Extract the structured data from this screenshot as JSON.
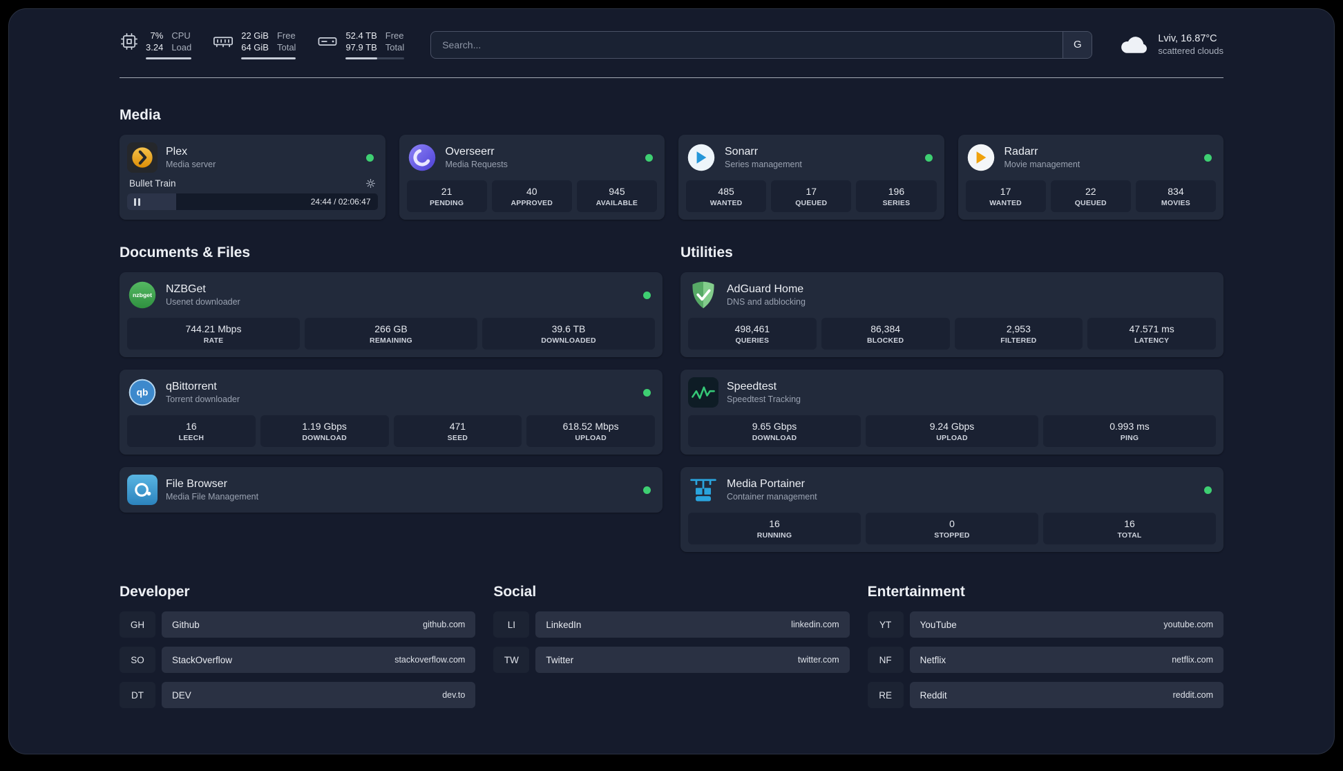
{
  "topbar": {
    "cpu": {
      "value_top": "7%",
      "value_bottom": "3.24",
      "label_top": "CPU",
      "label_bottom": "Load"
    },
    "memory": {
      "value_top": "22 GiB",
      "value_bottom": "64 GiB",
      "label_top": "Free",
      "label_bottom": "Total"
    },
    "disk": {
      "value_top": "52.4 TB",
      "value_bottom": "97.9 TB",
      "label_top": "Free",
      "label_bottom": "Total"
    },
    "search": {
      "placeholder": "Search...",
      "button": "G"
    },
    "weather": {
      "location": "Lviv, 16.87°C",
      "condition": "scattered clouds"
    }
  },
  "media": {
    "title": "Media",
    "plex": {
      "name": "Plex",
      "subtitle": "Media server",
      "now_playing": "Bullet Train",
      "time": "24:44 / 02:06:47"
    },
    "overseerr": {
      "name": "Overseerr",
      "subtitle": "Media Requests",
      "stats": [
        {
          "value": "21",
          "label": "PENDING"
        },
        {
          "value": "40",
          "label": "APPROVED"
        },
        {
          "value": "945",
          "label": "AVAILABLE"
        }
      ]
    },
    "sonarr": {
      "name": "Sonarr",
      "subtitle": "Series management",
      "stats": [
        {
          "value": "485",
          "label": "WANTED"
        },
        {
          "value": "17",
          "label": "QUEUED"
        },
        {
          "value": "196",
          "label": "SERIES"
        }
      ]
    },
    "radarr": {
      "name": "Radarr",
      "subtitle": "Movie management",
      "stats": [
        {
          "value": "17",
          "label": "WANTED"
        },
        {
          "value": "22",
          "label": "QUEUED"
        },
        {
          "value": "834",
          "label": "MOVIES"
        }
      ]
    }
  },
  "documents": {
    "title": "Documents & Files",
    "nzbget": {
      "name": "NZBGet",
      "subtitle": "Usenet downloader",
      "stats": [
        {
          "value": "744.21 Mbps",
          "label": "RATE"
        },
        {
          "value": "266 GB",
          "label": "REMAINING"
        },
        {
          "value": "39.6 TB",
          "label": "DOWNLOADED"
        }
      ]
    },
    "qbittorrent": {
      "name": "qBittorrent",
      "subtitle": "Torrent downloader",
      "stats": [
        {
          "value": "16",
          "label": "LEECH"
        },
        {
          "value": "1.19 Gbps",
          "label": "DOWNLOAD"
        },
        {
          "value": "471",
          "label": "SEED"
        },
        {
          "value": "618.52 Mbps",
          "label": "UPLOAD"
        }
      ]
    },
    "filebrowser": {
      "name": "File Browser",
      "subtitle": "Media File Management"
    }
  },
  "utilities": {
    "title": "Utilities",
    "adguard": {
      "name": "AdGuard Home",
      "subtitle": "DNS and adblocking",
      "stats": [
        {
          "value": "498,461",
          "label": "QUERIES"
        },
        {
          "value": "86,384",
          "label": "BLOCKED"
        },
        {
          "value": "2,953",
          "label": "FILTERED"
        },
        {
          "value": "47.571 ms",
          "label": "LATENCY"
        }
      ]
    },
    "speedtest": {
      "name": "Speedtest",
      "subtitle": "Speedtest Tracking",
      "stats": [
        {
          "value": "9.65 Gbps",
          "label": "DOWNLOAD"
        },
        {
          "value": "9.24 Gbps",
          "label": "UPLOAD"
        },
        {
          "value": "0.993 ms",
          "label": "PING"
        }
      ]
    },
    "portainer": {
      "name": "Media Portainer",
      "subtitle": "Container management",
      "stats": [
        {
          "value": "16",
          "label": "RUNNING"
        },
        {
          "value": "0",
          "label": "STOPPED"
        },
        {
          "value": "16",
          "label": "TOTAL"
        }
      ]
    }
  },
  "bookmarks": {
    "developer": {
      "title": "Developer",
      "items": [
        {
          "abbr": "GH",
          "name": "Github",
          "url": "github.com"
        },
        {
          "abbr": "SO",
          "name": "StackOverflow",
          "url": "stackoverflow.com"
        },
        {
          "abbr": "DT",
          "name": "DEV",
          "url": "dev.to"
        }
      ]
    },
    "social": {
      "title": "Social",
      "items": [
        {
          "abbr": "LI",
          "name": "LinkedIn",
          "url": "linkedin.com"
        },
        {
          "abbr": "TW",
          "name": "Twitter",
          "url": "twitter.com"
        }
      ]
    },
    "entertainment": {
      "title": "Entertainment",
      "items": [
        {
          "abbr": "YT",
          "name": "YouTube",
          "url": "youtube.com"
        },
        {
          "abbr": "NF",
          "name": "Netflix",
          "url": "netflix.com"
        },
        {
          "abbr": "RE",
          "name": "Reddit",
          "url": "reddit.com"
        }
      ]
    }
  },
  "colors": {
    "status_online": "#3ecf72",
    "accent_plex": "#e5a00d",
    "accent_speedtest": "#35c877",
    "accent_portainer": "#2aa4dd",
    "accent_overseerr": "#6c5ce7"
  }
}
